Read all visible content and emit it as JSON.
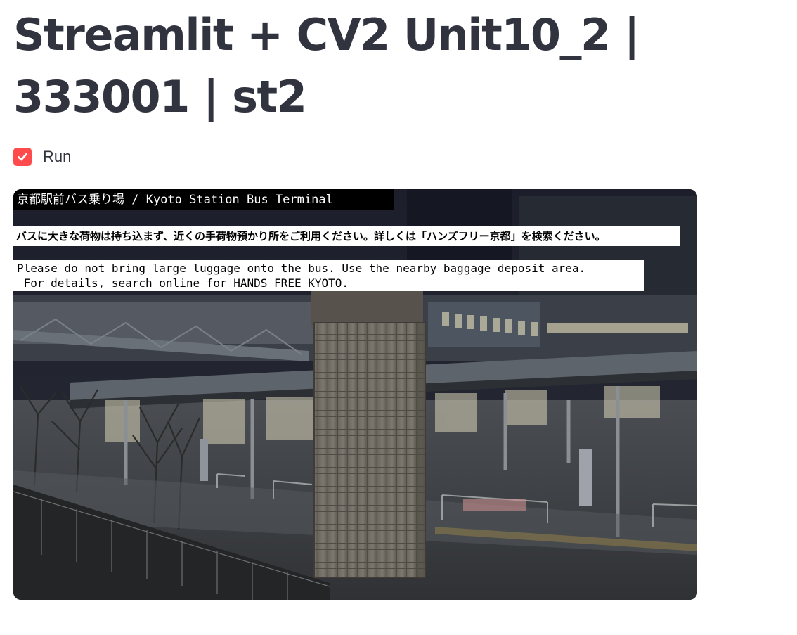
{
  "page": {
    "title": "Streamlit + CV2 Unit10_2 | 333001 | st2"
  },
  "run_checkbox": {
    "label": "Run",
    "checked": true,
    "accent_color": "#ff4b4b"
  },
  "video_feed": {
    "overlay_title": "京都駅前バス乗り場 / Kyoto Station Bus Terminal",
    "overlay_notice_jp": "バスに大きな荷物は持ち込まず、近くの手荷物預かり所をご利用ください。詳しくは「ハンズフリー京都」を検索ください。",
    "overlay_notice_en_line1": "Please do not bring large luggage onto the bus. Use the nearby baggage deposit area.",
    "overlay_notice_en_line2": " For details, search online for HANDS FREE KYOTO."
  }
}
